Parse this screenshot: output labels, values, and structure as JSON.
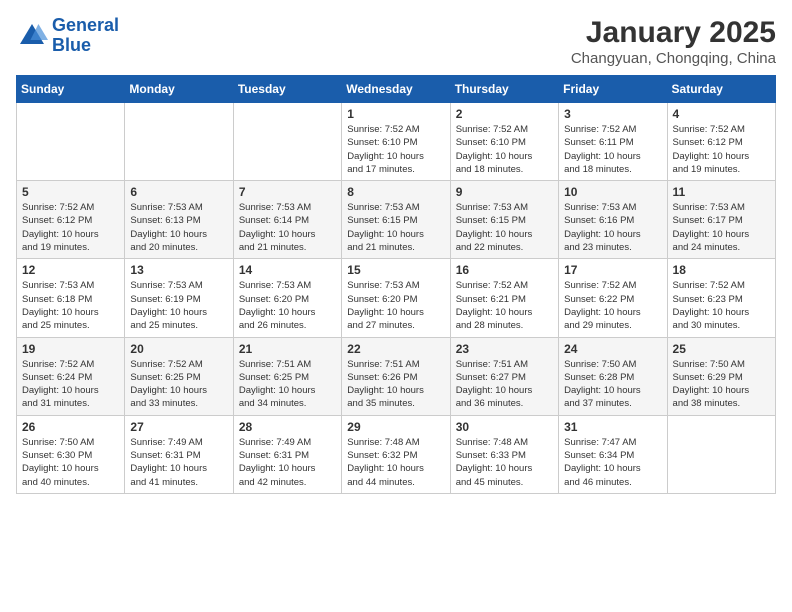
{
  "header": {
    "logo_general": "General",
    "logo_blue": "Blue",
    "month_year": "January 2025",
    "location": "Changyuan, Chongqing, China"
  },
  "weekdays": [
    "Sunday",
    "Monday",
    "Tuesday",
    "Wednesday",
    "Thursday",
    "Friday",
    "Saturday"
  ],
  "weeks": [
    [
      {
        "day": "",
        "info": ""
      },
      {
        "day": "",
        "info": ""
      },
      {
        "day": "",
        "info": ""
      },
      {
        "day": "1",
        "info": "Sunrise: 7:52 AM\nSunset: 6:10 PM\nDaylight: 10 hours\nand 17 minutes."
      },
      {
        "day": "2",
        "info": "Sunrise: 7:52 AM\nSunset: 6:10 PM\nDaylight: 10 hours\nand 18 minutes."
      },
      {
        "day": "3",
        "info": "Sunrise: 7:52 AM\nSunset: 6:11 PM\nDaylight: 10 hours\nand 18 minutes."
      },
      {
        "day": "4",
        "info": "Sunrise: 7:52 AM\nSunset: 6:12 PM\nDaylight: 10 hours\nand 19 minutes."
      }
    ],
    [
      {
        "day": "5",
        "info": "Sunrise: 7:52 AM\nSunset: 6:12 PM\nDaylight: 10 hours\nand 19 minutes."
      },
      {
        "day": "6",
        "info": "Sunrise: 7:53 AM\nSunset: 6:13 PM\nDaylight: 10 hours\nand 20 minutes."
      },
      {
        "day": "7",
        "info": "Sunrise: 7:53 AM\nSunset: 6:14 PM\nDaylight: 10 hours\nand 21 minutes."
      },
      {
        "day": "8",
        "info": "Sunrise: 7:53 AM\nSunset: 6:15 PM\nDaylight: 10 hours\nand 21 minutes."
      },
      {
        "day": "9",
        "info": "Sunrise: 7:53 AM\nSunset: 6:15 PM\nDaylight: 10 hours\nand 22 minutes."
      },
      {
        "day": "10",
        "info": "Sunrise: 7:53 AM\nSunset: 6:16 PM\nDaylight: 10 hours\nand 23 minutes."
      },
      {
        "day": "11",
        "info": "Sunrise: 7:53 AM\nSunset: 6:17 PM\nDaylight: 10 hours\nand 24 minutes."
      }
    ],
    [
      {
        "day": "12",
        "info": "Sunrise: 7:53 AM\nSunset: 6:18 PM\nDaylight: 10 hours\nand 25 minutes."
      },
      {
        "day": "13",
        "info": "Sunrise: 7:53 AM\nSunset: 6:19 PM\nDaylight: 10 hours\nand 25 minutes."
      },
      {
        "day": "14",
        "info": "Sunrise: 7:53 AM\nSunset: 6:20 PM\nDaylight: 10 hours\nand 26 minutes."
      },
      {
        "day": "15",
        "info": "Sunrise: 7:53 AM\nSunset: 6:20 PM\nDaylight: 10 hours\nand 27 minutes."
      },
      {
        "day": "16",
        "info": "Sunrise: 7:52 AM\nSunset: 6:21 PM\nDaylight: 10 hours\nand 28 minutes."
      },
      {
        "day": "17",
        "info": "Sunrise: 7:52 AM\nSunset: 6:22 PM\nDaylight: 10 hours\nand 29 minutes."
      },
      {
        "day": "18",
        "info": "Sunrise: 7:52 AM\nSunset: 6:23 PM\nDaylight: 10 hours\nand 30 minutes."
      }
    ],
    [
      {
        "day": "19",
        "info": "Sunrise: 7:52 AM\nSunset: 6:24 PM\nDaylight: 10 hours\nand 31 minutes."
      },
      {
        "day": "20",
        "info": "Sunrise: 7:52 AM\nSunset: 6:25 PM\nDaylight: 10 hours\nand 33 minutes."
      },
      {
        "day": "21",
        "info": "Sunrise: 7:51 AM\nSunset: 6:25 PM\nDaylight: 10 hours\nand 34 minutes."
      },
      {
        "day": "22",
        "info": "Sunrise: 7:51 AM\nSunset: 6:26 PM\nDaylight: 10 hours\nand 35 minutes."
      },
      {
        "day": "23",
        "info": "Sunrise: 7:51 AM\nSunset: 6:27 PM\nDaylight: 10 hours\nand 36 minutes."
      },
      {
        "day": "24",
        "info": "Sunrise: 7:50 AM\nSunset: 6:28 PM\nDaylight: 10 hours\nand 37 minutes."
      },
      {
        "day": "25",
        "info": "Sunrise: 7:50 AM\nSunset: 6:29 PM\nDaylight: 10 hours\nand 38 minutes."
      }
    ],
    [
      {
        "day": "26",
        "info": "Sunrise: 7:50 AM\nSunset: 6:30 PM\nDaylight: 10 hours\nand 40 minutes."
      },
      {
        "day": "27",
        "info": "Sunrise: 7:49 AM\nSunset: 6:31 PM\nDaylight: 10 hours\nand 41 minutes."
      },
      {
        "day": "28",
        "info": "Sunrise: 7:49 AM\nSunset: 6:31 PM\nDaylight: 10 hours\nand 42 minutes."
      },
      {
        "day": "29",
        "info": "Sunrise: 7:48 AM\nSunset: 6:32 PM\nDaylight: 10 hours\nand 44 minutes."
      },
      {
        "day": "30",
        "info": "Sunrise: 7:48 AM\nSunset: 6:33 PM\nDaylight: 10 hours\nand 45 minutes."
      },
      {
        "day": "31",
        "info": "Sunrise: 7:47 AM\nSunset: 6:34 PM\nDaylight: 10 hours\nand 46 minutes."
      },
      {
        "day": "",
        "info": ""
      }
    ]
  ]
}
